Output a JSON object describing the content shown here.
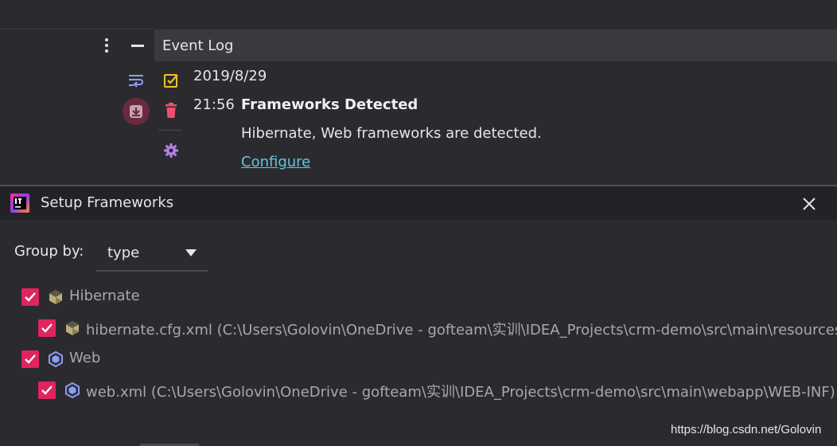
{
  "event_log": {
    "title": "Event Log",
    "date": "2019/8/29",
    "time": "21:56",
    "event_title": "Frameworks Detected",
    "event_message": "Hibernate, Web frameworks are detected.",
    "event_link": "Configure"
  },
  "dialog": {
    "title": "Setup Frameworks",
    "group_by_label": "Group by:",
    "group_by_value": "type",
    "items": [
      {
        "label": "Hibernate",
        "checked": true,
        "icon": "hibernate-icon"
      },
      {
        "label": "hibernate.cfg.xml (C:\\Users\\Golovin\\OneDrive - gofteam\\实训\\IDEA_Projects\\crm-demo\\src\\main\\resources)",
        "checked": true,
        "icon": "hibernate-icon"
      },
      {
        "label": "Web",
        "checked": true,
        "icon": "web-icon"
      },
      {
        "label": "web.xml (C:\\Users\\Golovin\\OneDrive - gofteam\\实训\\IDEA_Projects\\crm-demo\\src\\main\\webapp\\WEB-INF)",
        "checked": true,
        "icon": "web-icon"
      }
    ]
  },
  "watermark": "https://blog.csdn.net/Golovin",
  "colors": {
    "checkbox": "#e0245e",
    "link": "#62c6d8",
    "header_bg": "#3a3a3e",
    "dialog_title_bg": "#232327"
  }
}
